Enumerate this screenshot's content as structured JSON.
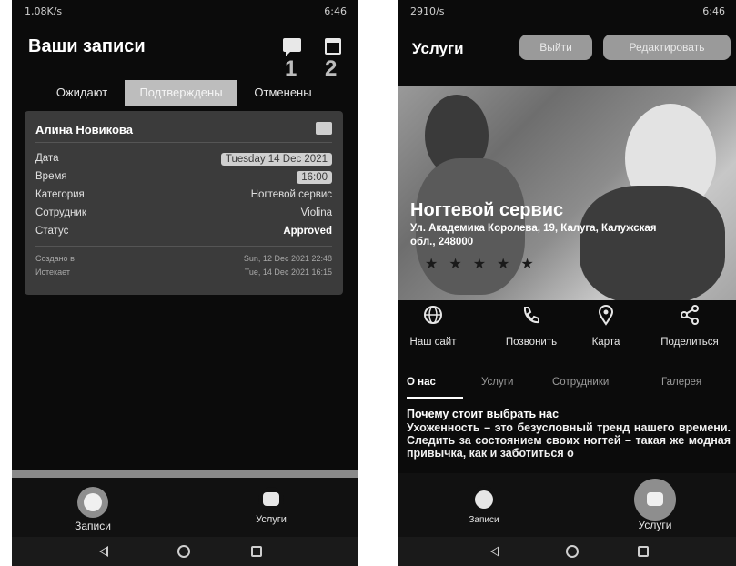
{
  "phone1": {
    "status": {
      "left": "1,08K/s",
      "right": "6:46"
    },
    "title": "Ваши записи",
    "header_numbers": [
      "1",
      "2"
    ],
    "icons": [
      "chat-icon",
      "calendar-icon"
    ],
    "tabs": [
      "Ожидают",
      "Подтверждены",
      "Отменены"
    ],
    "active_tab": "Подтверждены",
    "card": {
      "name": "Алина Новикова",
      "rows": [
        {
          "label": "Дата",
          "value": "Tuesday 14 Dec 2021"
        },
        {
          "label": "Время",
          "value": "16:00"
        },
        {
          "label": "Категория",
          "value": "Ногтевой сервис"
        },
        {
          "label": "Сотрудник",
          "value": "Violina"
        },
        {
          "label": "Статус",
          "value": "Approved"
        }
      ],
      "meta": [
        {
          "label": "Создано в",
          "value": "Sun, 12 Dec 2021 22:48"
        },
        {
          "label": "Истекает",
          "value": "Tue, 14 Dec 2021 16:15"
        }
      ]
    },
    "bottom_nav": [
      {
        "label": "Записи",
        "icon": "history-icon",
        "active": true
      },
      {
        "label": "Услуги",
        "icon": "store-icon",
        "active": false
      }
    ]
  },
  "phone2": {
    "status": {
      "left": "2910/s",
      "right": "6:46"
    },
    "title": "Услуги",
    "buttons": {
      "logout": "Выйти",
      "edit": "Редактировать"
    },
    "hero": {
      "title": "Ногтевой сервис",
      "address": "Ул. Академика Королева, 19, Калуга, Калужская обл., 248000",
      "rating": 5
    },
    "actions": [
      {
        "label": "Наш сайт",
        "icon": "globe-icon"
      },
      {
        "label": "Позвонить",
        "icon": "phone-icon"
      },
      {
        "label": "Карта",
        "icon": "map-pin-icon"
      },
      {
        "label": "Поделиться",
        "icon": "share-icon"
      }
    ],
    "tabs": [
      "О нас",
      "Услуги",
      "Сотрудники",
      "Галерея"
    ],
    "active_tab": "О нас",
    "about": {
      "heading": "Почему стоит выбрать нас",
      "text": "Ухоженность – это безусловный тренд нашего времени. Следить за состоянием своих ногтей – такая же модная привычка, как и заботиться о"
    },
    "bottom_nav": [
      {
        "label": "Записи",
        "icon": "history-icon",
        "active": false
      },
      {
        "label": "Услуги",
        "icon": "store-icon",
        "active": true
      }
    ]
  }
}
